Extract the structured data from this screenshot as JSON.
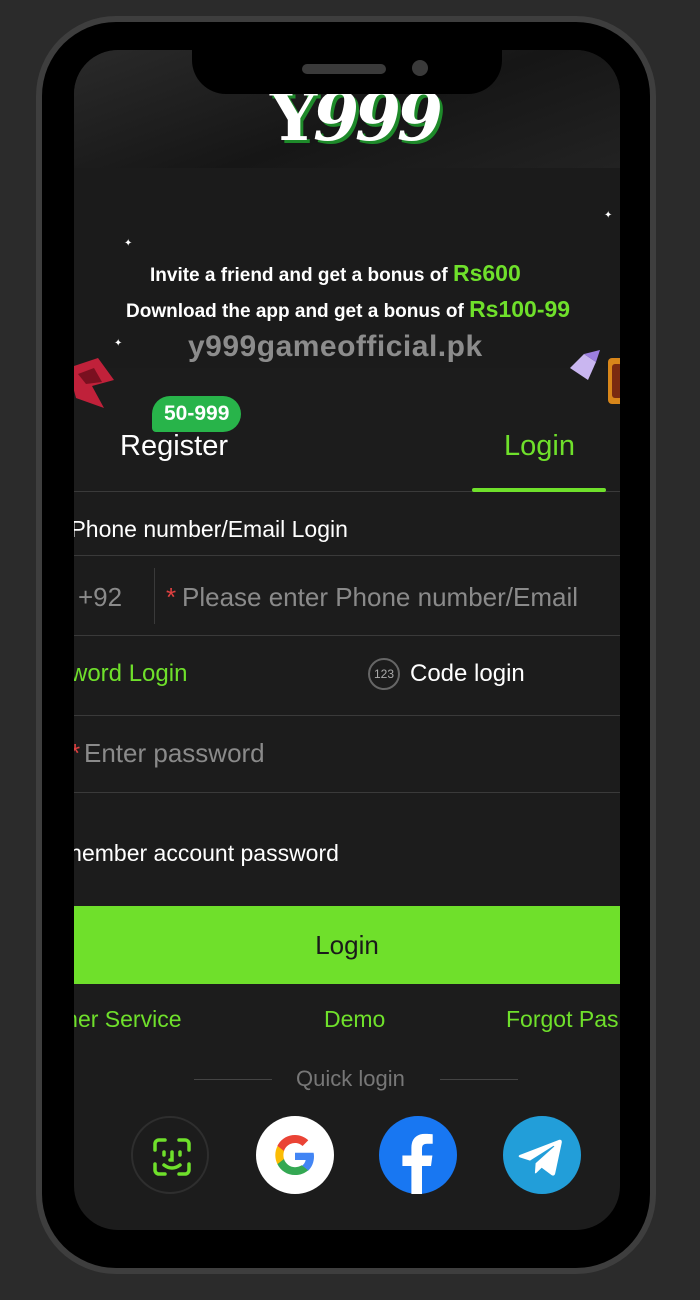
{
  "brand": {
    "logo_y": "Y",
    "logo_nines": "999",
    "colors": {
      "accent": "#6fe02b",
      "badge": "#28b44a",
      "required": "#e04040",
      "background": "#1c1c1c"
    }
  },
  "banner": {
    "line1_text": "Invite a friend and get a bonus of ",
    "line1_amount": "Rs600",
    "line2_text": "Download the app and get a bonus of ",
    "line2_amount": "Rs100-99"
  },
  "watermark": "y999gameofficial.pk",
  "tabs": {
    "register_label": "Register",
    "register_badge": "50-999",
    "login_label": "Login"
  },
  "form": {
    "section_title": "rt Phone number/Email Login",
    "country_code": "+92",
    "required_mark": "*",
    "phone_placeholder": "Please enter Phone number/Email",
    "password_login_label": "ssword Login",
    "code_login_icon": "123",
    "code_login_label": "Code login",
    "password_placeholder": "Enter password",
    "remember_label": "emember account password",
    "login_button": "Login"
  },
  "links": {
    "customer_service": "omer Service",
    "demo": "Demo",
    "forgot_password": "Forgot Pas"
  },
  "quick_login": {
    "label": "Quick login",
    "methods": [
      "face-id-icon",
      "google-icon",
      "facebook-icon",
      "telegram-icon"
    ]
  }
}
